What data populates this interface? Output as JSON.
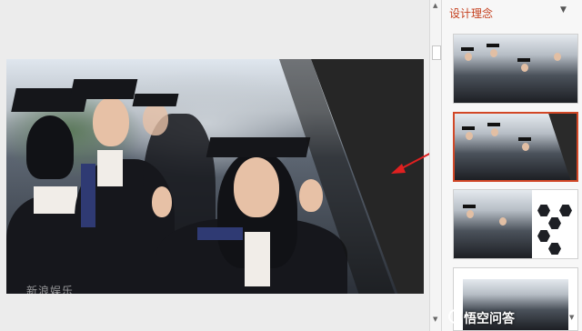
{
  "design_pane": {
    "title": "设计理念",
    "menu_icon": "chevron-down-icon"
  },
  "slide": {
    "watermark": "新浪娱乐"
  },
  "brand": {
    "text": "悟空问答",
    "icon": "wukong-logo-icon"
  },
  "colors": {
    "accent": "#d24726",
    "pane_title": "#c43e1c",
    "arrow": "#e02020",
    "overlay": "#262626"
  }
}
